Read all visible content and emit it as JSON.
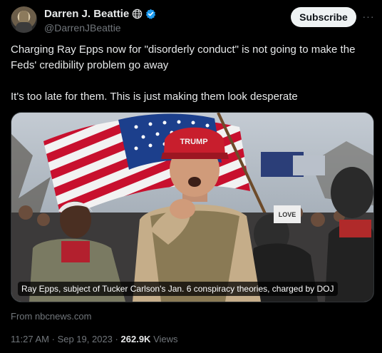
{
  "author": {
    "display_name": "Darren J. Beattie",
    "handle": "@DarrenJBeattie",
    "badges": [
      "globe-icon",
      "verified-badge-icon"
    ]
  },
  "actions": {
    "subscribe_label": "Subscribe",
    "more_label": "···"
  },
  "tweet": {
    "paragraphs": [
      "Charging Ray Epps now for \"disorderly conduct\" is not going to make the Feds' credibility problem go away",
      "It's too late for them. This is just making them look desperate"
    ]
  },
  "media": {
    "caption": "Ray Epps, subject of Tucker Carlson's Jan. 6 conspiracy theories, charged by DOJ",
    "hat_text": "TRUMP",
    "sign_text": "LOVE"
  },
  "link_source": "From nbcnews.com",
  "meta": {
    "time": "11:27 AM",
    "separator": "·",
    "date": "Sep 19, 2023",
    "views_count": "262.9K",
    "views_label": "Views"
  },
  "colors": {
    "background": "#000000",
    "text": "#e7e9ea",
    "muted": "#71767b",
    "verified": "#1d9bf0",
    "button_bg": "#eff3f4"
  }
}
